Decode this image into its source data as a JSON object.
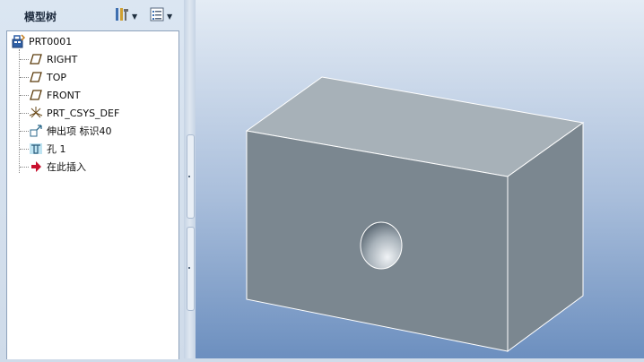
{
  "panel": {
    "title": "模型树",
    "toolbar": {
      "settings_icon": "tools-settings-icon",
      "show_icon": "tree-show-icon"
    }
  },
  "tree": {
    "items": [
      {
        "label": "PRT0001",
        "icon": "part-icon"
      },
      {
        "label": "RIGHT",
        "icon": "datum-plane-icon"
      },
      {
        "label": "TOP",
        "icon": "datum-plane-icon"
      },
      {
        "label": "FRONT",
        "icon": "datum-plane-icon"
      },
      {
        "label": "PRT_CSYS_DEF",
        "icon": "coordinate-system-icon"
      },
      {
        "label": "伸出项 标识40",
        "icon": "extrude-icon"
      },
      {
        "label": "孔 1",
        "icon": "hole-icon"
      },
      {
        "label": "在此插入",
        "icon": "insert-here-arrow-icon"
      }
    ]
  },
  "colors": {
    "model_side": "#7b8790",
    "model_top": "#a7b1b8",
    "viewport_top": "#e4ecf5",
    "viewport_bottom": "#6c8fbf",
    "insert_arrow": "#c8102e"
  }
}
